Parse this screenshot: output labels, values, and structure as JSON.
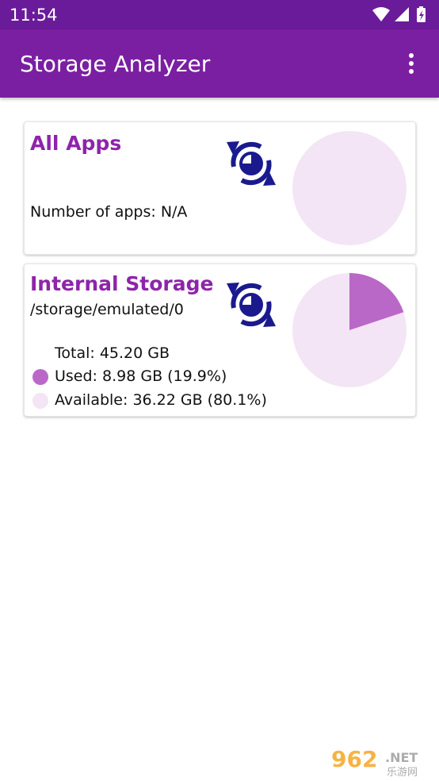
{
  "status_bar": {
    "time": "11:54",
    "icons": [
      "wifi-icon",
      "signal-icon",
      "battery-icon"
    ]
  },
  "app_bar": {
    "title": "Storage Analyzer",
    "menu_icon": "more-vert-icon"
  },
  "colors": {
    "status_bar": "#6a1b9a",
    "app_bar": "#7b1fa2",
    "title_accent": "#8e24aa",
    "used": "#ba68c8",
    "available": "#f3e5f5",
    "refresh_icon": "#1a1a8e"
  },
  "apps_card": {
    "title": "All Apps",
    "count_label": "Number of apps: N/A",
    "refresh_icon": "refresh-storage-icon",
    "used_fraction": 0
  },
  "storage_card": {
    "title": "Internal Storage",
    "path": "/storage/emulated/0",
    "total_label": "Total: 45.20 GB",
    "used_label": "Used: 8.98 GB (19.9%)",
    "available_label": "Available: 36.22 GB (80.1%)",
    "refresh_icon": "refresh-storage-icon",
    "used_fraction": 0.199,
    "available_fraction": 0.801
  },
  "watermark": {
    "brand": "962",
    "suffix": ".NET",
    "sub": "乐游网"
  }
}
